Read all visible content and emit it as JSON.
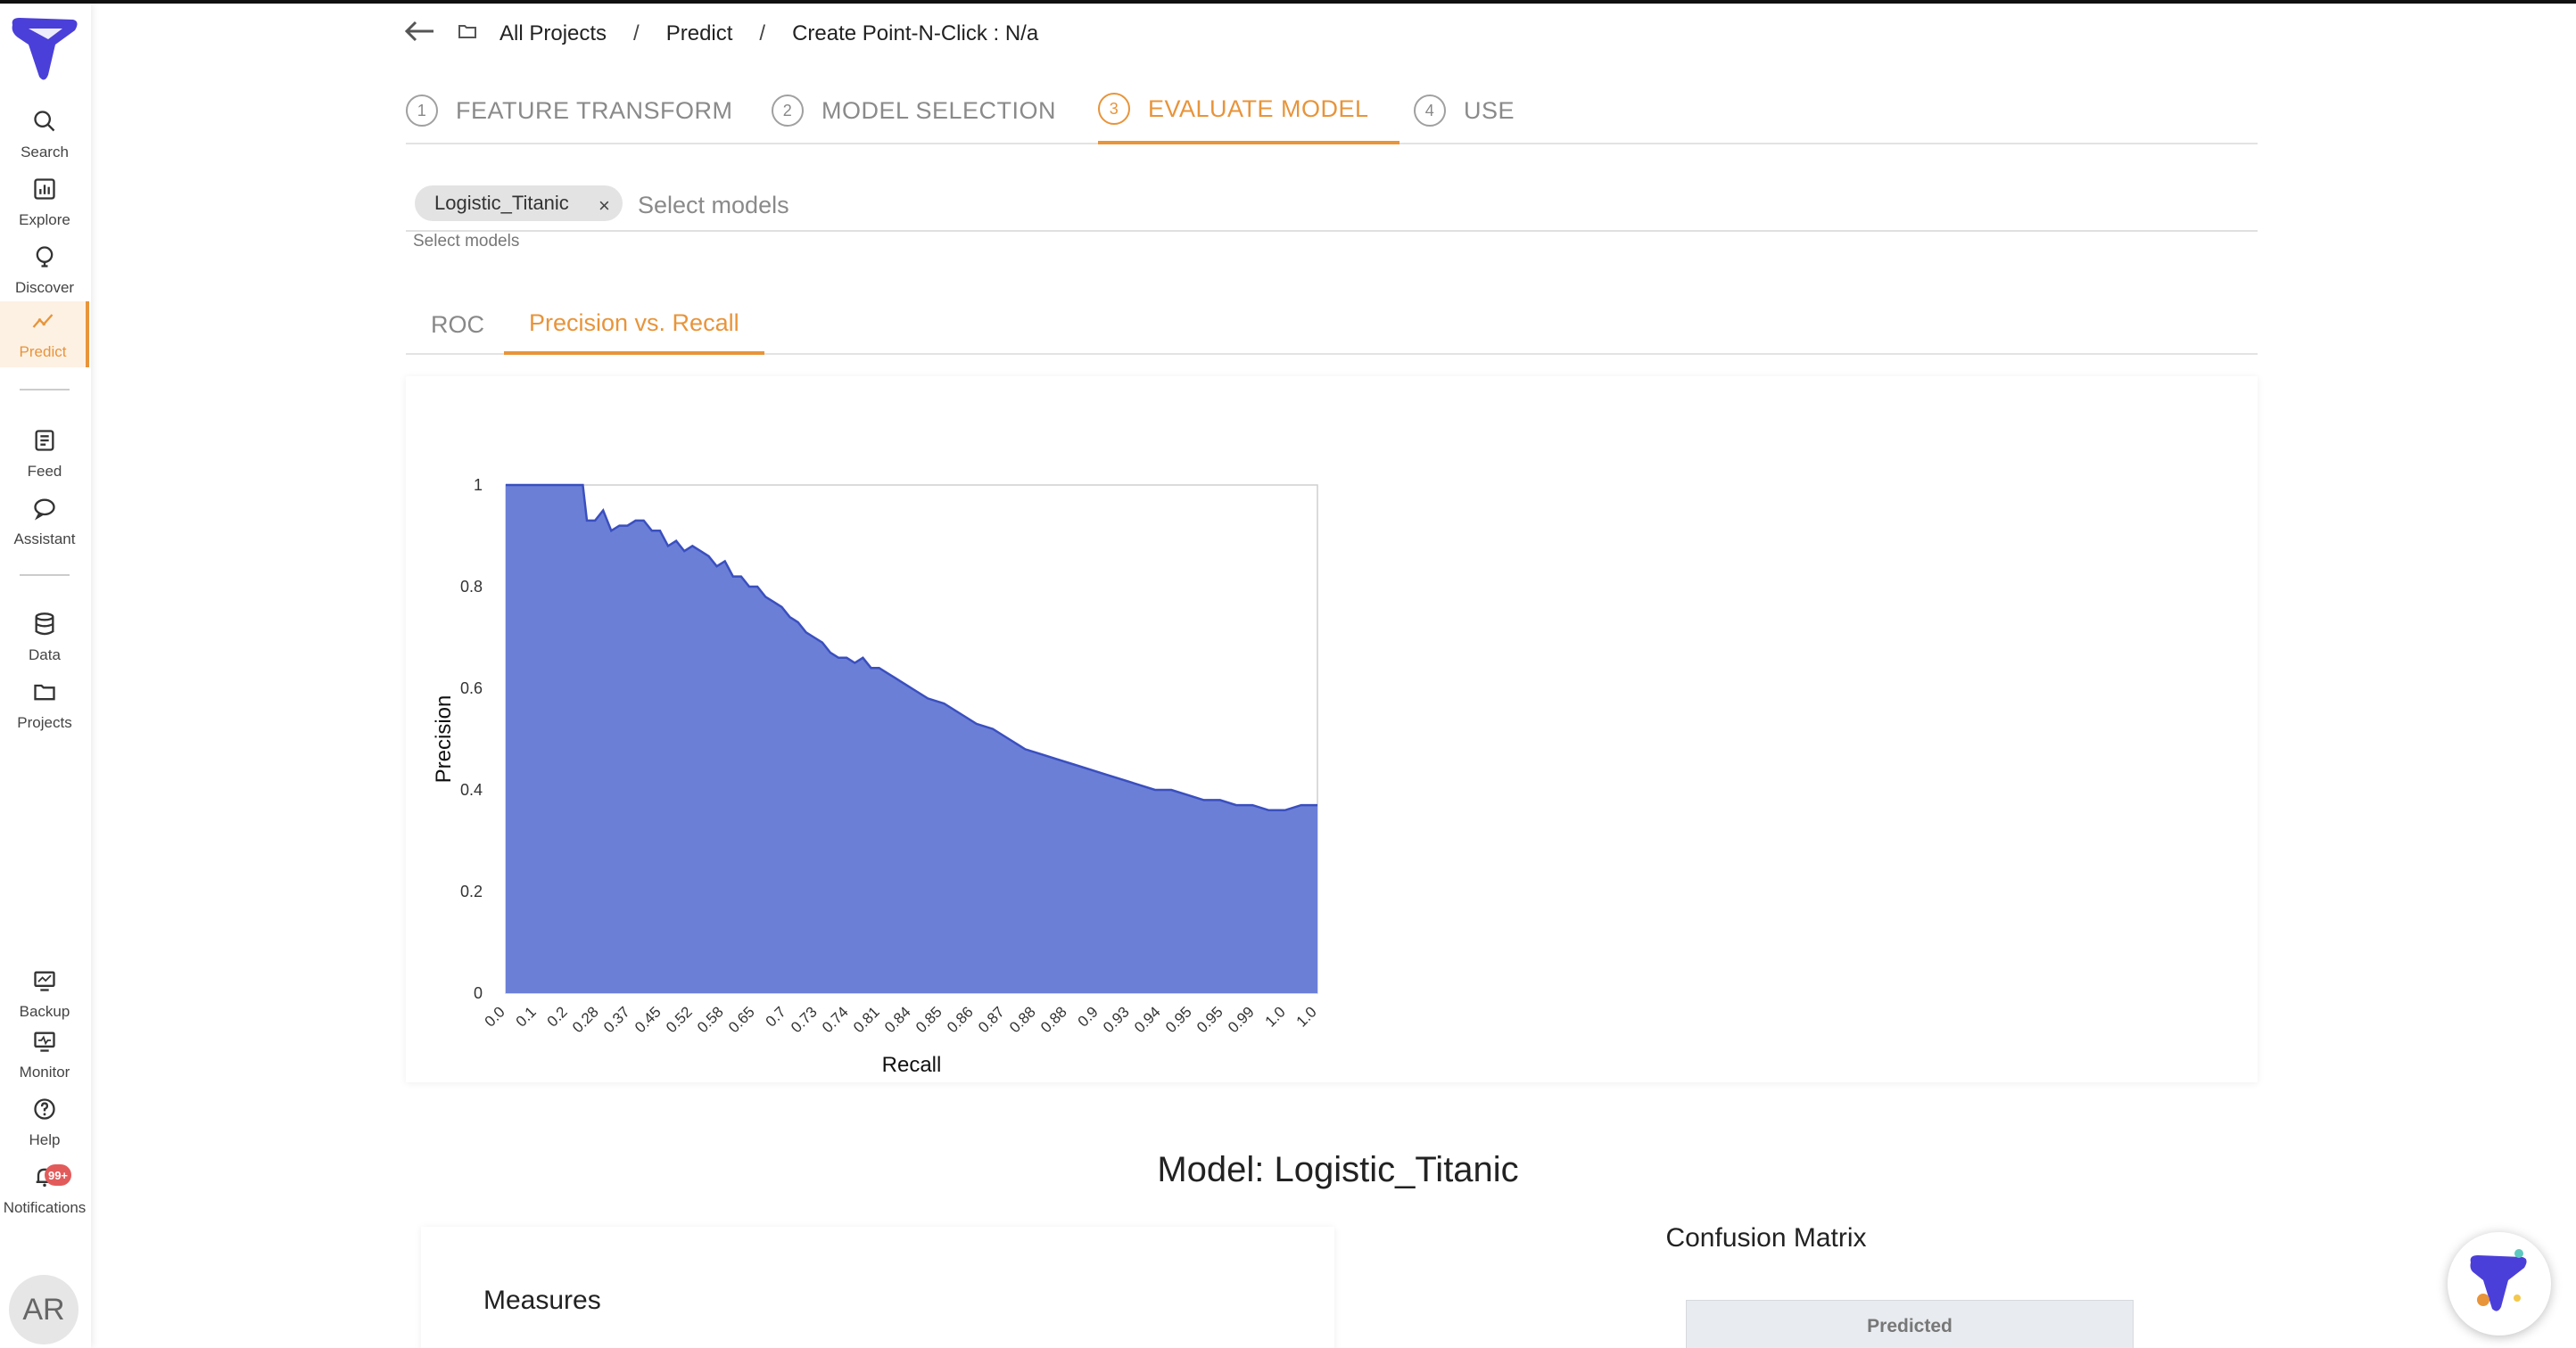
{
  "breadcrumb": {
    "all_projects": "All Projects",
    "predict": "Predict",
    "current": "Create Point-N-Click : N/a"
  },
  "sidebar": {
    "items": [
      {
        "label": "Search",
        "icon": "search-icon"
      },
      {
        "label": "Explore",
        "icon": "bar-chart-icon"
      },
      {
        "label": "Discover",
        "icon": "lightbulb-icon"
      },
      {
        "label": "Predict",
        "icon": "trend-icon",
        "active": true
      },
      {
        "label": "Feed",
        "icon": "feed-icon"
      },
      {
        "label": "Assistant",
        "icon": "chat-bubbles-icon"
      },
      {
        "label": "Data",
        "icon": "database-icon"
      },
      {
        "label": "Projects",
        "icon": "folder-icon"
      },
      {
        "label": "Backup",
        "icon": "backup-icon"
      },
      {
        "label": "Monitor",
        "icon": "monitor-icon"
      },
      {
        "label": "Help",
        "icon": "help-icon"
      },
      {
        "label": "Notifications",
        "icon": "bell-icon"
      }
    ],
    "notifications_badge": "99+",
    "avatar_initials": "AR"
  },
  "steps": [
    {
      "num": "1",
      "label": "FEATURE TRANSFORM"
    },
    {
      "num": "2",
      "label": "MODEL SELECTION"
    },
    {
      "num": "3",
      "label": "EVALUATE MODEL",
      "active": true
    },
    {
      "num": "4",
      "label": "USE"
    }
  ],
  "model_select": {
    "chip": "Logistic_Titanic",
    "chip_remove": "×",
    "placeholder": "Select models",
    "helper": "Select models"
  },
  "chart_tabs": [
    {
      "label": "ROC"
    },
    {
      "label": "Precision vs. Recall",
      "active": true
    }
  ],
  "model_heading": "Model: Logistic_Titanic",
  "measures_title": "Measures",
  "confusion_matrix": {
    "title": "Confusion Matrix",
    "header": "Predicted"
  },
  "colors": {
    "accent": "#e8943a",
    "area_fill": "#6b7fd7",
    "area_stroke": "#3a4fbf"
  },
  "chart_data": {
    "type": "area",
    "xlabel": "Recall",
    "ylabel": "Precision",
    "ylim": [
      0,
      1
    ],
    "yticks": [
      "0",
      "0.2",
      "0.4",
      "0.6",
      "0.8",
      "1"
    ],
    "xticks": [
      "0.0",
      "0.1",
      "0.2",
      "0.28",
      "0.37",
      "0.45",
      "0.52",
      "0.58",
      "0.65",
      "0.7",
      "0.73",
      "0.74",
      "0.81",
      "0.84",
      "0.85",
      "0.86",
      "0.87",
      "0.88",
      "0.88",
      "0.9",
      "0.93",
      "0.94",
      "0.95",
      "0.95",
      "0.99",
      "1.0",
      "1.0"
    ],
    "grid": false,
    "x": [
      0,
      0.02,
      0.04,
      0.06,
      0.08,
      0.095,
      0.1,
      0.11,
      0.12,
      0.13,
      0.14,
      0.15,
      0.16,
      0.17,
      0.18,
      0.19,
      0.2,
      0.21,
      0.22,
      0.23,
      0.24,
      0.25,
      0.26,
      0.27,
      0.28,
      0.29,
      0.3,
      0.31,
      0.32,
      0.33,
      0.34,
      0.35,
      0.36,
      0.37,
      0.38,
      0.39,
      0.4,
      0.41,
      0.42,
      0.43,
      0.44,
      0.45,
      0.46,
      0.47,
      0.48,
      0.5,
      0.52,
      0.54,
      0.56,
      0.58,
      0.6,
      0.62,
      0.64,
      0.66,
      0.68,
      0.7,
      0.72,
      0.74,
      0.76,
      0.78,
      0.8,
      0.82,
      0.84,
      0.86,
      0.88,
      0.9,
      0.92,
      0.94,
      0.95,
      0.96,
      0.98,
      1.0
    ],
    "y": [
      1,
      1,
      1,
      1,
      1,
      1,
      0.93,
      0.93,
      0.95,
      0.91,
      0.92,
      0.92,
      0.93,
      0.93,
      0.91,
      0.91,
      0.88,
      0.89,
      0.87,
      0.88,
      0.87,
      0.86,
      0.84,
      0.85,
      0.82,
      0.82,
      0.8,
      0.8,
      0.78,
      0.77,
      0.76,
      0.74,
      0.73,
      0.71,
      0.7,
      0.69,
      0.67,
      0.66,
      0.66,
      0.65,
      0.66,
      0.64,
      0.64,
      0.63,
      0.62,
      0.6,
      0.58,
      0.57,
      0.55,
      0.53,
      0.52,
      0.5,
      0.48,
      0.47,
      0.46,
      0.45,
      0.44,
      0.43,
      0.42,
      0.41,
      0.4,
      0.4,
      0.39,
      0.38,
      0.38,
      0.37,
      0.37,
      0.36,
      0.36,
      0.36,
      0.37,
      0.37
    ]
  }
}
